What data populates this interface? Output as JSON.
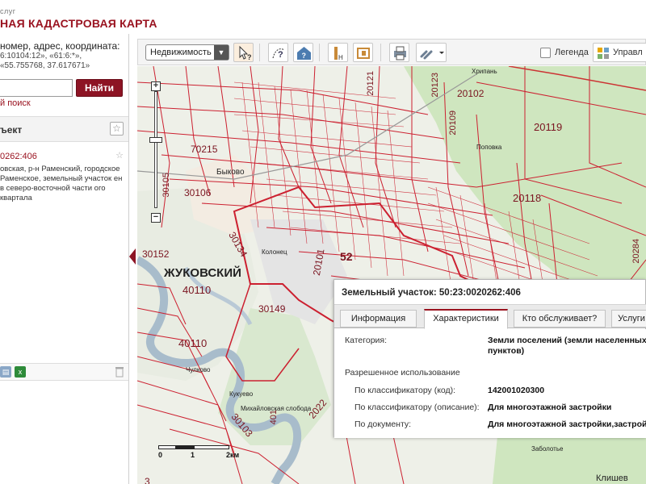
{
  "header": {
    "small": "слуг",
    "title": "НАЯ КАДАСТРОВАЯ КАРТА"
  },
  "search": {
    "hint": "номер, адрес, координата:",
    "example1": "6:10104:12», «61:6:*»,",
    "example2": "«55.755768, 37.617671»",
    "placeholder": "",
    "find_label": "Найти",
    "advanced_label": "й поиск"
  },
  "object_panel": {
    "header": "ъект",
    "cadastral_id": "0262:406",
    "description": "овская, р-н Раменский, городское Раменское, земельный участок ен в северо-восточной части ого квартала"
  },
  "toolbar": {
    "layer_select": "Недвижимость",
    "legend_label": "Легенда",
    "manage_label": "Управл"
  },
  "map": {
    "parcel_labels": [
      "20121",
      "20123",
      "20102",
      "20109",
      "20119",
      "20118",
      "70215",
      "30105",
      "30106",
      "30152",
      "30134",
      "40110",
      "30149",
      "40110",
      "20101",
      "52",
      "20284",
      "401",
      "2022",
      "30103",
      "3"
    ],
    "place_labels": [
      "Хрипань",
      "Поповка",
      "Быково",
      "Колонец",
      "Кукуево",
      "Михайловская слобода",
      "Заболотье",
      "Клишев",
      "ЖУКОВСКИЙ",
      "Чулково"
    ],
    "scale": {
      "ticks": [
        "0",
        "1",
        "2км"
      ]
    }
  },
  "popup": {
    "title": "Земельный участок: 50:23:0020262:406",
    "tabs": [
      "Информация",
      "Характеристики",
      "Кто обслуживает?",
      "Услуги"
    ],
    "active_tab": 1,
    "rows": {
      "category_label": "Категория:",
      "category_value": "Земли поселений (земли населенных пунктов)",
      "permitted_header": "Разрешенное использование",
      "code_label": "По классификатору (код):",
      "code_value": "142001020300",
      "desc_label": "По классификатору (описание):",
      "desc_value": "Для многоэтажной застройки",
      "doc_label": "По документу:",
      "doc_value": "Для многоэтажной застройки,застрой"
    }
  },
  "colors": {
    "accent": "#9a1320",
    "parcel_line": "#cc2030",
    "forest": "#cfe6bf",
    "water": "#c7d3df"
  }
}
